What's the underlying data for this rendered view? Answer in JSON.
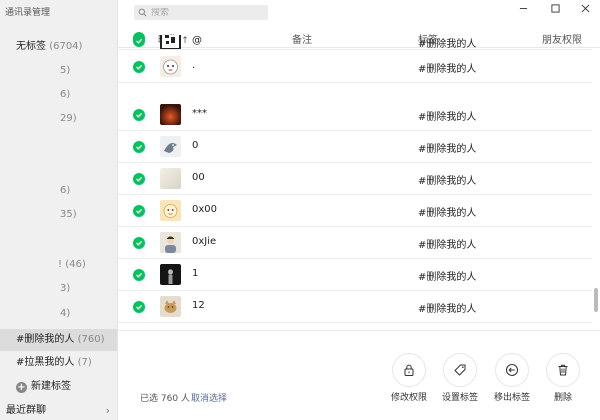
{
  "app_title": "通讯录管理",
  "sidebar": {
    "tags": [
      {
        "label": "无标签",
        "count": "(6704)"
      },
      {
        "label": "",
        "count": "5)"
      },
      {
        "label": "",
        "count": "6)"
      },
      {
        "label": "",
        "count": "29)"
      },
      {
        "label": "",
        "count": "6)"
      },
      {
        "label": "",
        "count": "35)"
      },
      {
        "label": "!",
        "count": "(46)"
      },
      {
        "label": "",
        "count": "3)"
      },
      {
        "label": "",
        "count": "4)"
      },
      {
        "label": "#删除我的人",
        "count": "(760)"
      },
      {
        "label": "#拉黑我的人",
        "count": "(7)"
      }
    ],
    "new_tag": "新建标签",
    "recent_groups": "最近群聊"
  },
  "search": {
    "placeholder": "搜索"
  },
  "header": {
    "nickname": "昵称",
    "sort_arrow": "↑",
    "remark": "备注",
    "tag": "标签",
    "permission": "朋友权限"
  },
  "rows": [
    {
      "nick": "@",
      "tag": "#删除我的人",
      "avatar": "qr"
    },
    {
      "nick": ".",
      "tag": "#删除我的人",
      "avatar": "cat"
    },
    {
      "nick": "***",
      "tag": "#删除我的人",
      "avatar": "fire"
    },
    {
      "nick": "0",
      "tag": "#删除我的人",
      "avatar": "shark"
    },
    {
      "nick": "00",
      "tag": "#删除我的人",
      "avatar": "light"
    },
    {
      "nick": "0x00",
      "tag": "#删除我的人",
      "avatar": "cartoon"
    },
    {
      "nick": "0xJie",
      "tag": "#删除我的人",
      "avatar": "person"
    },
    {
      "nick": "1",
      "tag": "#删除我的人",
      "avatar": "dark"
    },
    {
      "nick": "12",
      "tag": "#删除我的人",
      "avatar": "cat2"
    }
  ],
  "bottom": {
    "selected_label": "已选 760 人",
    "cancel_label": "取消选择",
    "actions": [
      {
        "label": "修改权限",
        "icon": "lock-icon"
      },
      {
        "label": "设置标签",
        "icon": "tag-icon"
      },
      {
        "label": "移出标签",
        "icon": "remove-icon"
      },
      {
        "label": "删除",
        "icon": "trash-icon"
      }
    ]
  },
  "colors": {
    "accent": "#07c160",
    "link": "#576b95"
  }
}
